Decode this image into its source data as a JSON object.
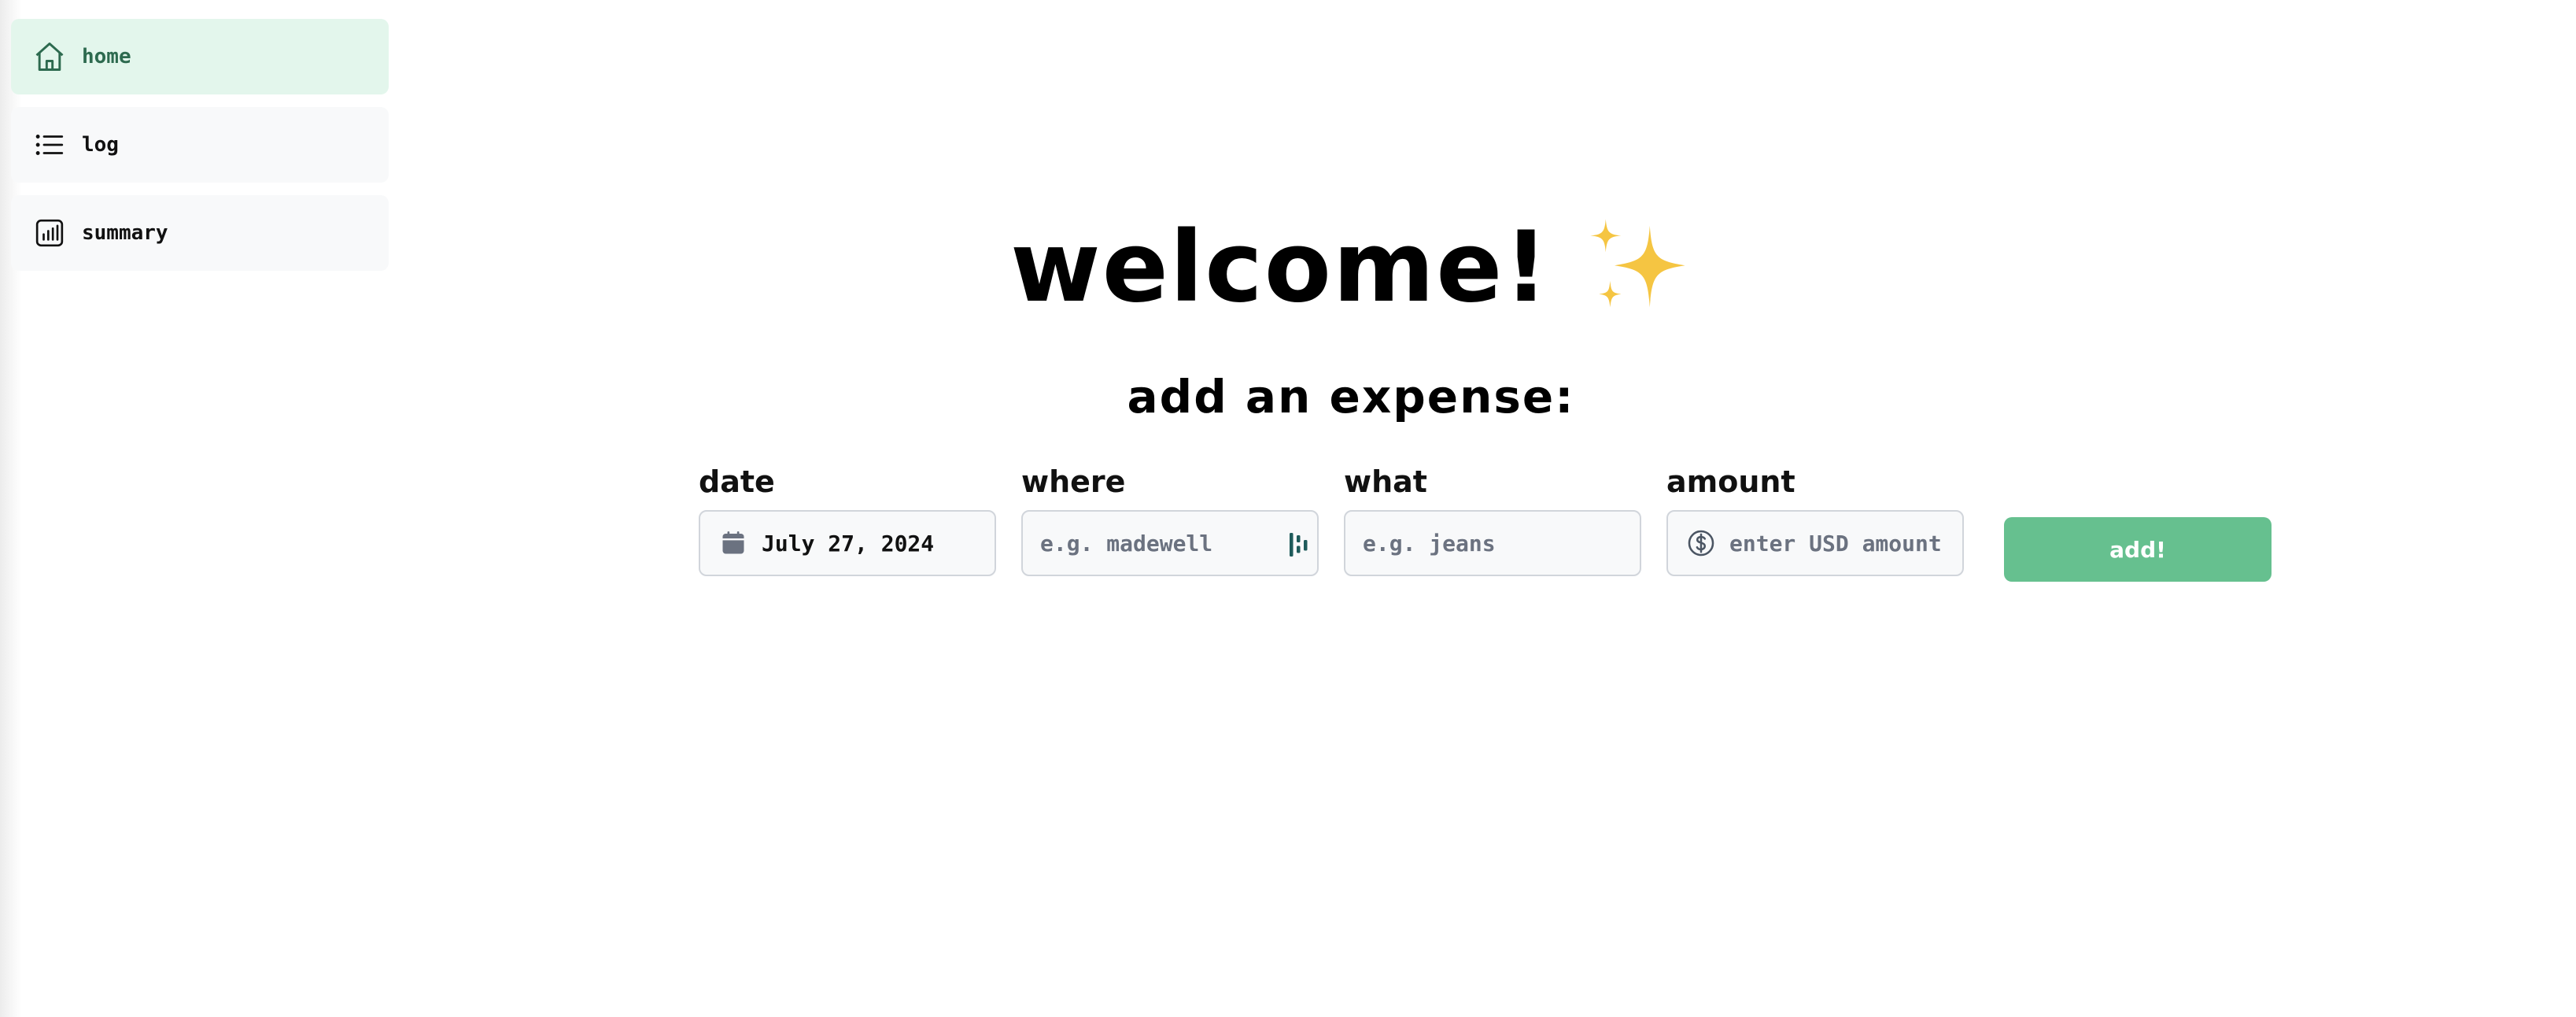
{
  "sidebar": {
    "items": [
      {
        "label": "home",
        "icon": "home-icon",
        "active": true
      },
      {
        "label": "log",
        "icon": "list-icon",
        "active": false
      },
      {
        "label": "summary",
        "icon": "bar-chart-icon",
        "active": false
      }
    ]
  },
  "main": {
    "title": "welcome!",
    "title_emoji_icon": "sparkles-icon",
    "subtitle": "add an expense:",
    "form": {
      "date": {
        "label": "date",
        "value": "July 27, 2024",
        "icon": "calendar-icon"
      },
      "where": {
        "label": "where",
        "placeholder": "e.g. madewell",
        "trailing_icon": "autofill-icon"
      },
      "what": {
        "label": "what",
        "placeholder": "e.g. jeans"
      },
      "amount": {
        "label": "amount",
        "placeholder": "enter USD amount",
        "icon": "dollar-icon"
      },
      "submit_label": "add!"
    }
  },
  "colors": {
    "accent": "#66c08f",
    "active_nav_bg": "#e3f6ec",
    "active_nav_text": "#2d6a4f",
    "sparkle": "#f5c542"
  }
}
